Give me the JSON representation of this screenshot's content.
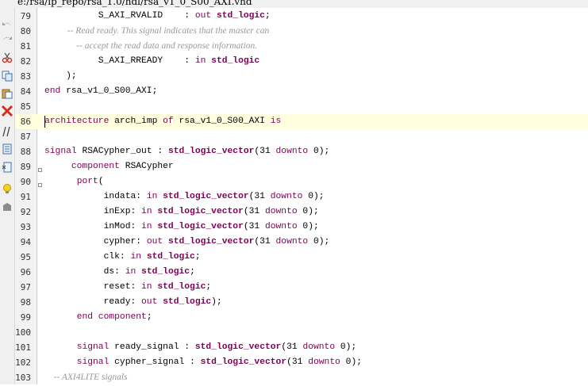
{
  "title_path": "e:/rsa/ip_repo/rsa_1.0/hdl/rsa_v1_0_S00_AXI.vhd",
  "toolbar_icons": [
    "undo-icon",
    "redo-icon",
    "cut-icon",
    "copy-icon",
    "paste-icon",
    "delete-icon",
    "comment-icon",
    "indent-icon",
    "uncomment-icon",
    "bulb-icon",
    "misc-icon"
  ],
  "colors": {
    "keyword": "#7f0055",
    "comment": "#999999",
    "current_line": "#ffffe0",
    "gutter": "#f2f2f2"
  },
  "current_line": 86,
  "lines": [
    {
      "n": "79",
      "tokens": [
        {
          "t": "          S_AXI_RVALID    : ",
          "k": "tx"
        },
        {
          "t": "out",
          "k": "kw"
        },
        {
          "t": " ",
          "k": "tx"
        },
        {
          "t": "std_logic",
          "k": "ty"
        },
        {
          "t": ";",
          "k": "tx"
        }
      ]
    },
    {
      "n": "80",
      "tokens": [
        {
          "t": "          -- Read ready. This signal indicates that the master can",
          "k": "cm"
        }
      ]
    },
    {
      "n": "81",
      "tokens": [
        {
          "t": "              -- accept the read data and response information.",
          "k": "cm"
        }
      ]
    },
    {
      "n": "82",
      "tokens": [
        {
          "t": "          S_AXI_RREADY    : ",
          "k": "tx"
        },
        {
          "t": "in",
          "k": "kw"
        },
        {
          "t": " ",
          "k": "tx"
        },
        {
          "t": "std_logic",
          "k": "ty"
        }
      ]
    },
    {
      "n": "83",
      "tokens": [
        {
          "t": "    );",
          "k": "tx"
        }
      ]
    },
    {
      "n": "84",
      "tokens": [
        {
          "t": "end",
          "k": "kw"
        },
        {
          "t": " rsa_v1_0_S00_AXI;",
          "k": "tx"
        }
      ]
    },
    {
      "n": "85",
      "tokens": []
    },
    {
      "n": "86",
      "tokens": [
        {
          "t": "architecture",
          "k": "kw"
        },
        {
          "t": " arch_imp ",
          "k": "tx"
        },
        {
          "t": "of",
          "k": "kw"
        },
        {
          "t": " rsa_v1_0_S00_AXI ",
          "k": "tx"
        },
        {
          "t": "is",
          "k": "kw"
        }
      ]
    },
    {
      "n": "87",
      "tokens": []
    },
    {
      "n": "88",
      "tokens": [
        {
          "t": "signal",
          "k": "kw"
        },
        {
          "t": " RSACypher_out : ",
          "k": "tx"
        },
        {
          "t": "std_logic_vector",
          "k": "ty"
        },
        {
          "t": "(31 ",
          "k": "tx"
        },
        {
          "t": "downto",
          "k": "kw"
        },
        {
          "t": " 0);",
          "k": "tx"
        }
      ]
    },
    {
      "n": "89",
      "tokens": [
        {
          "t": "     ",
          "k": "tx"
        },
        {
          "t": "component",
          "k": "kw"
        },
        {
          "t": " RSACypher",
          "k": "tx"
        }
      ]
    },
    {
      "n": "90",
      "tokens": [
        {
          "t": "      ",
          "k": "tx"
        },
        {
          "t": "port",
          "k": "kw"
        },
        {
          "t": "(",
          "k": "tx"
        }
      ]
    },
    {
      "n": "91",
      "tokens": [
        {
          "t": "           indata: ",
          "k": "tx"
        },
        {
          "t": "in",
          "k": "kw"
        },
        {
          "t": " ",
          "k": "tx"
        },
        {
          "t": "std_logic_vector",
          "k": "ty"
        },
        {
          "t": "(31 ",
          "k": "tx"
        },
        {
          "t": "downto",
          "k": "kw"
        },
        {
          "t": " 0);",
          "k": "tx"
        }
      ]
    },
    {
      "n": "92",
      "tokens": [
        {
          "t": "           inExp: ",
          "k": "tx"
        },
        {
          "t": "in",
          "k": "kw"
        },
        {
          "t": " ",
          "k": "tx"
        },
        {
          "t": "std_logic_vector",
          "k": "ty"
        },
        {
          "t": "(31 ",
          "k": "tx"
        },
        {
          "t": "downto",
          "k": "kw"
        },
        {
          "t": " 0);",
          "k": "tx"
        }
      ]
    },
    {
      "n": "93",
      "tokens": [
        {
          "t": "           inMod: ",
          "k": "tx"
        },
        {
          "t": "in",
          "k": "kw"
        },
        {
          "t": " ",
          "k": "tx"
        },
        {
          "t": "std_logic_vector",
          "k": "ty"
        },
        {
          "t": "(31 ",
          "k": "tx"
        },
        {
          "t": "downto",
          "k": "kw"
        },
        {
          "t": " 0);",
          "k": "tx"
        }
      ]
    },
    {
      "n": "94",
      "tokens": [
        {
          "t": "           cypher: ",
          "k": "tx"
        },
        {
          "t": "out",
          "k": "kw"
        },
        {
          "t": " ",
          "k": "tx"
        },
        {
          "t": "std_logic_vector",
          "k": "ty"
        },
        {
          "t": "(31 ",
          "k": "tx"
        },
        {
          "t": "downto",
          "k": "kw"
        },
        {
          "t": " 0);",
          "k": "tx"
        }
      ]
    },
    {
      "n": "95",
      "tokens": [
        {
          "t": "           clk: ",
          "k": "tx"
        },
        {
          "t": "in",
          "k": "kw"
        },
        {
          "t": " ",
          "k": "tx"
        },
        {
          "t": "std_logic",
          "k": "ty"
        },
        {
          "t": ";",
          "k": "tx"
        }
      ]
    },
    {
      "n": "96",
      "tokens": [
        {
          "t": "           ds: ",
          "k": "tx"
        },
        {
          "t": "in",
          "k": "kw"
        },
        {
          "t": " ",
          "k": "tx"
        },
        {
          "t": "std_logic",
          "k": "ty"
        },
        {
          "t": ";",
          "k": "tx"
        }
      ]
    },
    {
      "n": "97",
      "tokens": [
        {
          "t": "           reset: ",
          "k": "tx"
        },
        {
          "t": "in",
          "k": "kw"
        },
        {
          "t": " ",
          "k": "tx"
        },
        {
          "t": "std_logic",
          "k": "ty"
        },
        {
          "t": ";",
          "k": "tx"
        }
      ]
    },
    {
      "n": "98",
      "tokens": [
        {
          "t": "           ready: ",
          "k": "tx"
        },
        {
          "t": "out",
          "k": "kw"
        },
        {
          "t": " ",
          "k": "tx"
        },
        {
          "t": "std_logic",
          "k": "ty"
        },
        {
          "t": ");",
          "k": "tx"
        }
      ]
    },
    {
      "n": "99",
      "tokens": [
        {
          "t": "      ",
          "k": "tx"
        },
        {
          "t": "end component",
          "k": "kw"
        },
        {
          "t": ";",
          "k": "tx"
        }
      ]
    },
    {
      "n": "100",
      "tokens": []
    },
    {
      "n": "101",
      "tokens": [
        {
          "t": "      ",
          "k": "tx"
        },
        {
          "t": "signal",
          "k": "kw"
        },
        {
          "t": " ready_signal : ",
          "k": "tx"
        },
        {
          "t": "std_logic_vector",
          "k": "ty"
        },
        {
          "t": "(31 ",
          "k": "tx"
        },
        {
          "t": "downto",
          "k": "kw"
        },
        {
          "t": " 0);",
          "k": "tx"
        }
      ]
    },
    {
      "n": "102",
      "tokens": [
        {
          "t": "      ",
          "k": "tx"
        },
        {
          "t": "signal",
          "k": "kw"
        },
        {
          "t": " cypher_signal : ",
          "k": "tx"
        },
        {
          "t": "std_logic_vector",
          "k": "ty"
        },
        {
          "t": "(31 ",
          "k": "tx"
        },
        {
          "t": "downto",
          "k": "kw"
        },
        {
          "t": " 0);",
          "k": "tx"
        }
      ]
    },
    {
      "n": "103",
      "tokens": [
        {
          "t": "    -- AXI4LITE signals",
          "k": "cm"
        }
      ]
    }
  ]
}
